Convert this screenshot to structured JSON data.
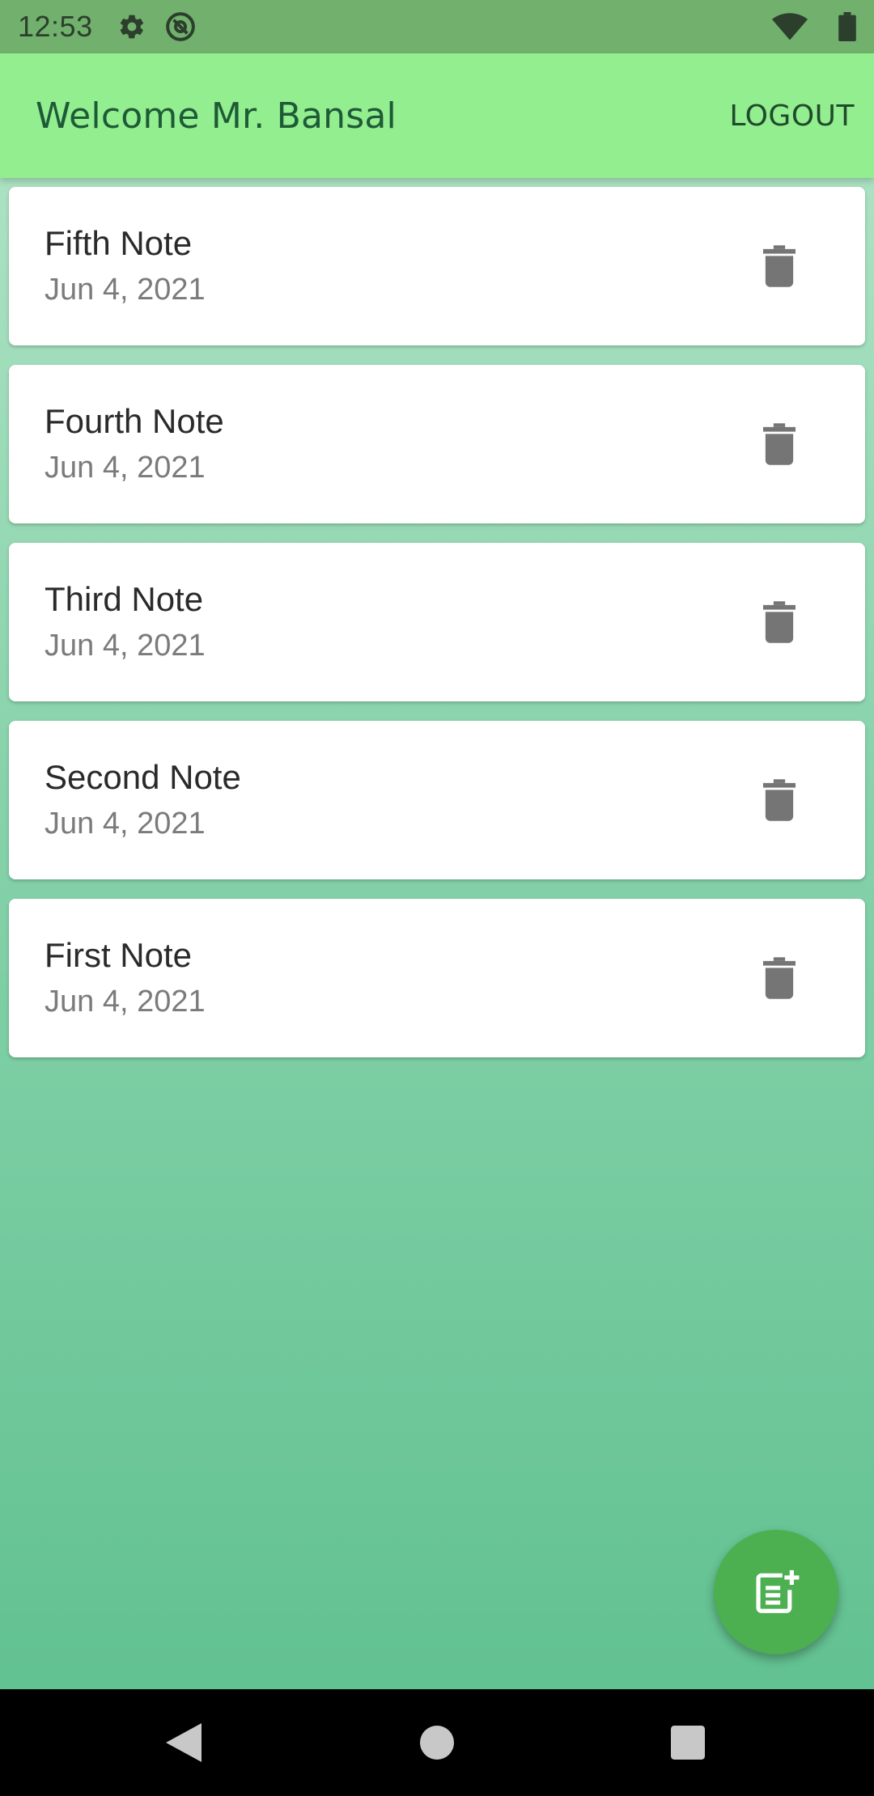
{
  "status_bar": {
    "time": "12:53",
    "left_icons": [
      "gear-icon",
      "at-sign-icon"
    ],
    "right_icons": [
      "wifi-icon",
      "battery-icon"
    ],
    "color": "#72b06d"
  },
  "app_bar": {
    "title": "Welcome Mr. Bansal",
    "logout_label": "LOGOUT",
    "color": "#93ee8f"
  },
  "notes": [
    {
      "title": "Fifth Note",
      "date": "Jun 4, 2021"
    },
    {
      "title": "Fourth Note",
      "date": "Jun 4, 2021"
    },
    {
      "title": "Third Note",
      "date": "Jun 4, 2021"
    },
    {
      "title": "Second Note",
      "date": "Jun 4, 2021"
    },
    {
      "title": "First Note",
      "date": "Jun 4, 2021"
    }
  ],
  "note_actions": {
    "delete_icon": "trash-icon"
  },
  "fab": {
    "icon": "add-note-icon",
    "color": "#4caf50"
  },
  "nav_bar": {
    "buttons": [
      "back-icon",
      "home-icon",
      "recents-icon"
    ]
  }
}
